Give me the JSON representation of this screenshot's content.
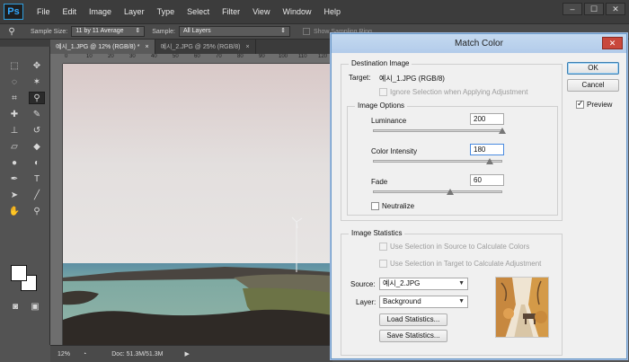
{
  "app": {
    "logo": "Ps"
  },
  "menu": [
    "File",
    "Edit",
    "Image",
    "Layer",
    "Type",
    "Select",
    "Filter",
    "View",
    "Window",
    "Help"
  ],
  "window_controls": {
    "minimize": "–",
    "maximize": "☐",
    "close": "✕"
  },
  "options_bar": {
    "sample_size_label": "Sample Size:",
    "sample_size_value": "11 by 11 Average",
    "sample_label": "Sample:",
    "sample_value": "All Layers",
    "show_sampling_ring": "Show Sampling Ring"
  },
  "tabs": [
    {
      "label": "예시_1.JPG @ 12% (RGB/8) *",
      "close": "×"
    },
    {
      "label": "예시_2.JPG @ 25% (RGB/8)",
      "close": "×"
    }
  ],
  "ruler": [
    "0",
    "10",
    "20",
    "30",
    "40",
    "50",
    "60",
    "70",
    "80",
    "90",
    "100",
    "110",
    "120"
  ],
  "status": {
    "zoom": "12%",
    "doc": "Doc: 51.3M/51.3M"
  },
  "dialog": {
    "title": "Match Color",
    "close": "✕",
    "destination": {
      "legend": "Destination Image",
      "target_label": "Target:",
      "target_value": "예시_1.JPG (RGB/8)",
      "ignore_selection": "Ignore Selection when Applying Adjustment",
      "image_options": {
        "legend": "Image Options",
        "luminance_label": "Luminance",
        "luminance_value": "200",
        "luminance_level": 1.0,
        "color_intensity_label": "Color Intensity",
        "color_intensity_value": "180",
        "color_intensity_level": 0.9,
        "fade_label": "Fade",
        "fade_value": "60",
        "fade_level": 0.6,
        "neutralize": "Neutralize"
      }
    },
    "statistics": {
      "legend": "Image Statistics",
      "use_source": "Use Selection in Source to Calculate Colors",
      "use_target": "Use Selection in Target to Calculate Adjustment",
      "source_label": "Source:",
      "source_value": "예시_2.JPG",
      "layer_label": "Layer:",
      "layer_value": "Background",
      "load": "Load Statistics...",
      "save": "Save Statistics..."
    },
    "buttons": {
      "ok": "OK",
      "cancel": "Cancel",
      "preview": "Preview"
    },
    "preview_checked": true
  }
}
